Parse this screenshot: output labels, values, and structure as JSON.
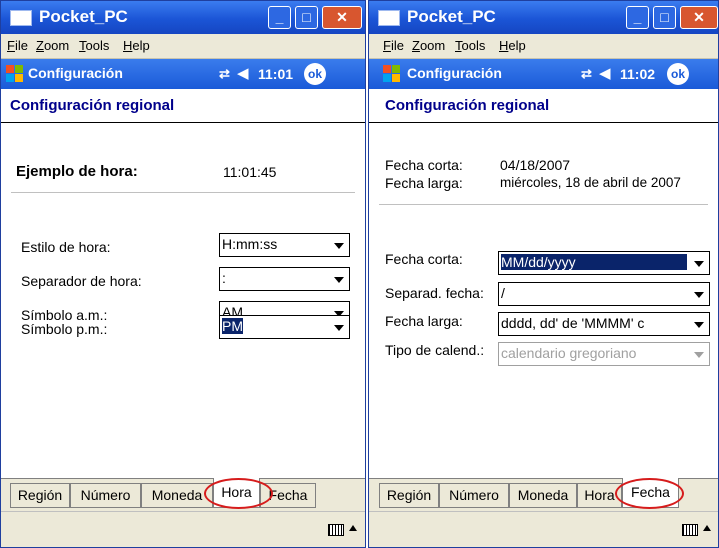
{
  "window_title": "Pocket_PC",
  "menu": [
    "File",
    "Zoom",
    "Tools",
    "Help"
  ],
  "nav_title": "Configuración",
  "page_title": "Configuración regional",
  "win1": {
    "clock": "11:01",
    "ok": "ok",
    "example_label": "Ejemplo de hora:",
    "example_value": "11:01:45",
    "fields": [
      {
        "label": "Estilo de hora:",
        "value": "H:mm:ss"
      },
      {
        "label": "Separador de hora:",
        "value": ":"
      },
      {
        "label": "Símbolo a.m.:",
        "value": "AM"
      },
      {
        "label": "Símbolo p.m.:",
        "value": "PM"
      }
    ],
    "tabs": [
      "Región",
      "Número",
      "Moneda",
      "Hora",
      "Fecha"
    ],
    "active_tab": "Hora"
  },
  "win2": {
    "clock": "11:02",
    "ok": "ok",
    "samples": [
      {
        "label": "Fecha corta:",
        "value": "04/18/2007"
      },
      {
        "label": "Fecha larga:",
        "value": "miércoles, 18 de abril de 2007"
      }
    ],
    "fields": [
      {
        "label": "Fecha corta:",
        "value": "MM/dd/yyyy"
      },
      {
        "label": "Separad. fecha:",
        "value": "/"
      },
      {
        "label": "Fecha larga:",
        "value": "dddd, dd' de 'MMMM' c"
      },
      {
        "label": "Tipo de calend.:",
        "value": "calendario gregoriano"
      }
    ],
    "tabs": [
      "Región",
      "Número",
      "Moneda",
      "Hora",
      "Fecha"
    ],
    "active_tab": "Fecha"
  },
  "colors": {
    "titlebar": "#1b55d6",
    "highlight": "#0a246a",
    "circle": "#d61c1c",
    "page_title": "#00008b"
  }
}
